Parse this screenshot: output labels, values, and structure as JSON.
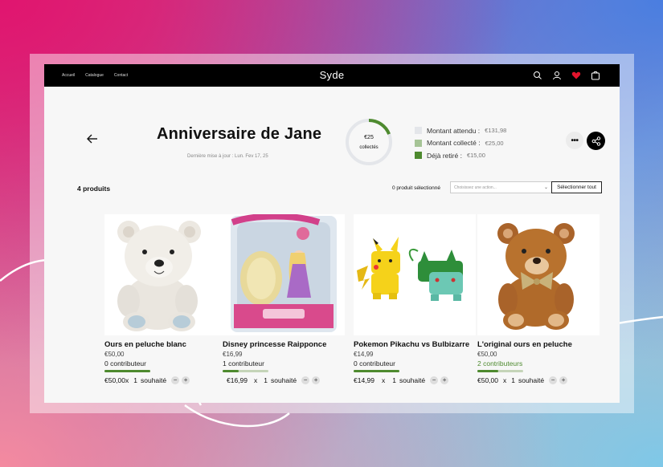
{
  "nav": {
    "items": [
      "Accueil",
      "Catalogue",
      "Contact"
    ]
  },
  "brand": "Syde",
  "header_icons": [
    "search-icon",
    "user-icon",
    "heart-icon",
    "bag-icon"
  ],
  "page": {
    "title": "Anniversaire de Jane",
    "updated": "Dernière mise à jour : Lun. Fev 17, 25"
  },
  "progress": {
    "amount": "€25",
    "label": "collectés",
    "fraction": 0.19
  },
  "legend": [
    {
      "label": "Montant attendu :",
      "value": "€131,98",
      "color": "#e4e6ea"
    },
    {
      "label": "Montant collecté :",
      "value": "€25,00",
      "color": "#a6c496"
    },
    {
      "label": "Déjà retiré :",
      "value": "€15,00",
      "color": "#4e8a2f"
    }
  ],
  "toolbar": {
    "count": "4 produits",
    "selected": "0 produit sélectionné",
    "action_placeholder": "Choisissez une action...",
    "select_all": "Sélectionner tout"
  },
  "products": [
    {
      "name": "Ours en peluche blanc",
      "price": "€50,00",
      "contributors": "0 contributeur",
      "progress": 1.0,
      "qty_price": "€50,00",
      "x": "x",
      "qty": "1",
      "wish": "souhaité"
    },
    {
      "name": "Disney princesse Raipponce",
      "price": "€16,99",
      "contributors": "1 contributeur",
      "progress": 0.35,
      "qty_price": "€16,99",
      "x": "x",
      "qty": "1",
      "wish": "souhaité"
    },
    {
      "name": "Pokemon Pikachu vs Bulbizarre",
      "price": "€14,99",
      "contributors": "0 contributeur",
      "progress": 1.0,
      "qty_price": "€14,99",
      "x": "x",
      "qty": "1",
      "wish": "souhaité"
    },
    {
      "name": "L'original ours en peluche",
      "price": "€50,00",
      "contributors": "2 contributeurs",
      "progress": 0.45,
      "qty_price": "€50,00",
      "x": "x",
      "qty": "1",
      "wish": "souhaité"
    }
  ],
  "stepper": {
    "minus": "−",
    "plus": "+"
  }
}
